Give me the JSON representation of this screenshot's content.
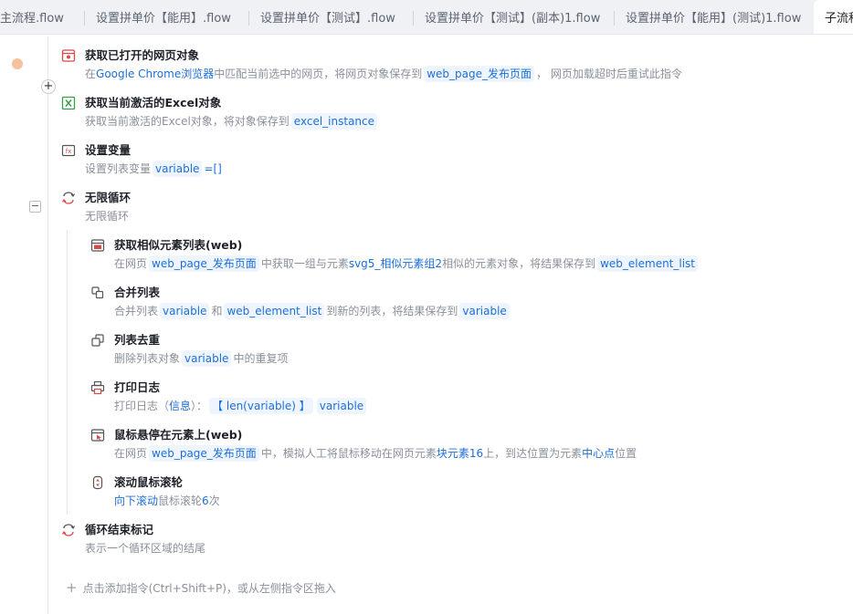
{
  "tabs": [
    {
      "label": "主流程.flow"
    },
    {
      "label": "设置拼单价【能用】.flow"
    },
    {
      "label": "设置拼单价【测试】.flow"
    },
    {
      "label": "设置拼单价【测试】(副本)1.flow"
    },
    {
      "label": "设置拼单价【能用】(测试)1.flow"
    },
    {
      "label": "子流程"
    }
  ],
  "steps": [
    {
      "icon": "webpage-icon",
      "title": "获取已打开的网页对象",
      "desc": {
        "p1": "在",
        "h1": "Google Chrome浏览器",
        "p2": "中匹配当前选中的网页，将网页对象保存到",
        "c1": "web_page_发布页面",
        "p3": "， 网页加载超时后重试此指令"
      }
    },
    {
      "icon": "excel-icon",
      "title": "获取当前激活的Excel对象",
      "desc": {
        "p1": "获取当前激活的Excel对象，将对象保存到",
        "c1": "excel_instance"
      }
    },
    {
      "icon": "variable-icon",
      "title": "设置变量",
      "desc": {
        "p1": "设置列表变量",
        "c1": "variable",
        "h1": "=[]"
      }
    },
    {
      "icon": "loop-icon",
      "title": "无限循环",
      "desc": {
        "p1": "无限循环"
      }
    },
    {
      "icon": "web-elements-icon",
      "title": "获取相似元素列表(web)",
      "desc": {
        "p1": "在网页",
        "c1": "web_page_发布页面",
        "p2": "中获取一组与元素",
        "h1": "svg5_相似元素组2",
        "p3": "相似的元素对象，将结果保存到",
        "c2": "web_element_list"
      }
    },
    {
      "icon": "merge-list-icon",
      "title": "合并列表",
      "desc": {
        "p1": "合并列表",
        "c1": "variable",
        "p2": "和",
        "c2": "web_element_list",
        "p3": "到新的列表，将结果保存到",
        "c3": "variable"
      }
    },
    {
      "icon": "dedupe-icon",
      "title": "列表去重",
      "desc": {
        "p1": "删除列表对象",
        "c1": "variable",
        "p2": "中的重复项"
      }
    },
    {
      "icon": "printer-icon",
      "title": "打印日志",
      "desc": {
        "p1": "打印日志（",
        "h1": "信息",
        "p2": "）：",
        "c1": "【  len(variable) 】",
        "c2": "variable"
      }
    },
    {
      "icon": "hover-icon",
      "title": "鼠标悬停在元素上(web)",
      "desc": {
        "p1": "在网页",
        "c1": "web_page_发布页面",
        "p2": "中，模拟人工将鼠标移动在网页元素",
        "h1": "块元素16",
        "p3": "上，到达位置为元素",
        "h2": "中心点",
        "p4": "位置"
      }
    },
    {
      "icon": "scroll-wheel-icon",
      "title": "滚动鼠标滚轮",
      "desc": {
        "h1": "向下滚动",
        "p1": "鼠标滚轮",
        "h2": "6",
        "p2": "次"
      }
    },
    {
      "icon": "loop-end-icon",
      "title": "循环结束标记",
      "desc": {
        "p1": "表示一个循环区域的结尾"
      }
    }
  ],
  "add_hint": "点击添加指令(Ctrl+Shift+P)，或从左侧指令区拖入",
  "colors": {
    "accent": "#1d6fd6",
    "chip_bg": "#eef5ff",
    "breakpoint": "#f5c29d"
  }
}
